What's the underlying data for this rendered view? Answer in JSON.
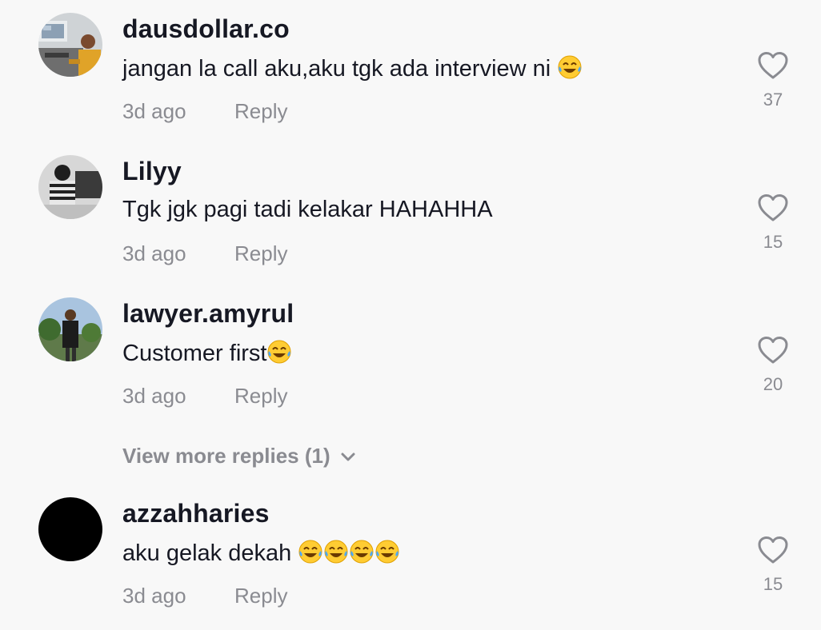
{
  "comments": [
    {
      "username": "dausdollar.co",
      "text": "jangan la call aku,aku tgk ada interview ni ",
      "emoji_count": 1,
      "time": "3d ago",
      "reply": "Reply",
      "likes": "37",
      "avatar_icon": "desk-setup-photo"
    },
    {
      "username": "Lilyy",
      "text": "Tgk jgk pagi tadi kelakar HAHAHHA",
      "emoji_count": 0,
      "time": "3d ago",
      "reply": "Reply",
      "likes": "15",
      "avatar_icon": "sitting-person-photo"
    },
    {
      "username": "lawyer.amyrul",
      "text": "Customer first",
      "emoji_count": 1,
      "time": "3d ago",
      "reply": "Reply",
      "likes": "20",
      "avatar_icon": "outdoor-person-photo"
    },
    {
      "username": "azzahharies",
      "text": "aku gelak dekah ",
      "emoji_count": 4,
      "time": "3d ago",
      "reply": "Reply",
      "likes": "15",
      "avatar_icon": "black-circle"
    }
  ],
  "view_more": "View more replies (1)",
  "icons": {
    "like": "heart-outline-icon",
    "expand": "chevron-down-icon",
    "emoji": "face-with-tears-of-joy-emoji"
  },
  "colors": {
    "background": "#f8f8f8",
    "primary_text": "#161823",
    "secondary_text": "#8a8b91"
  }
}
